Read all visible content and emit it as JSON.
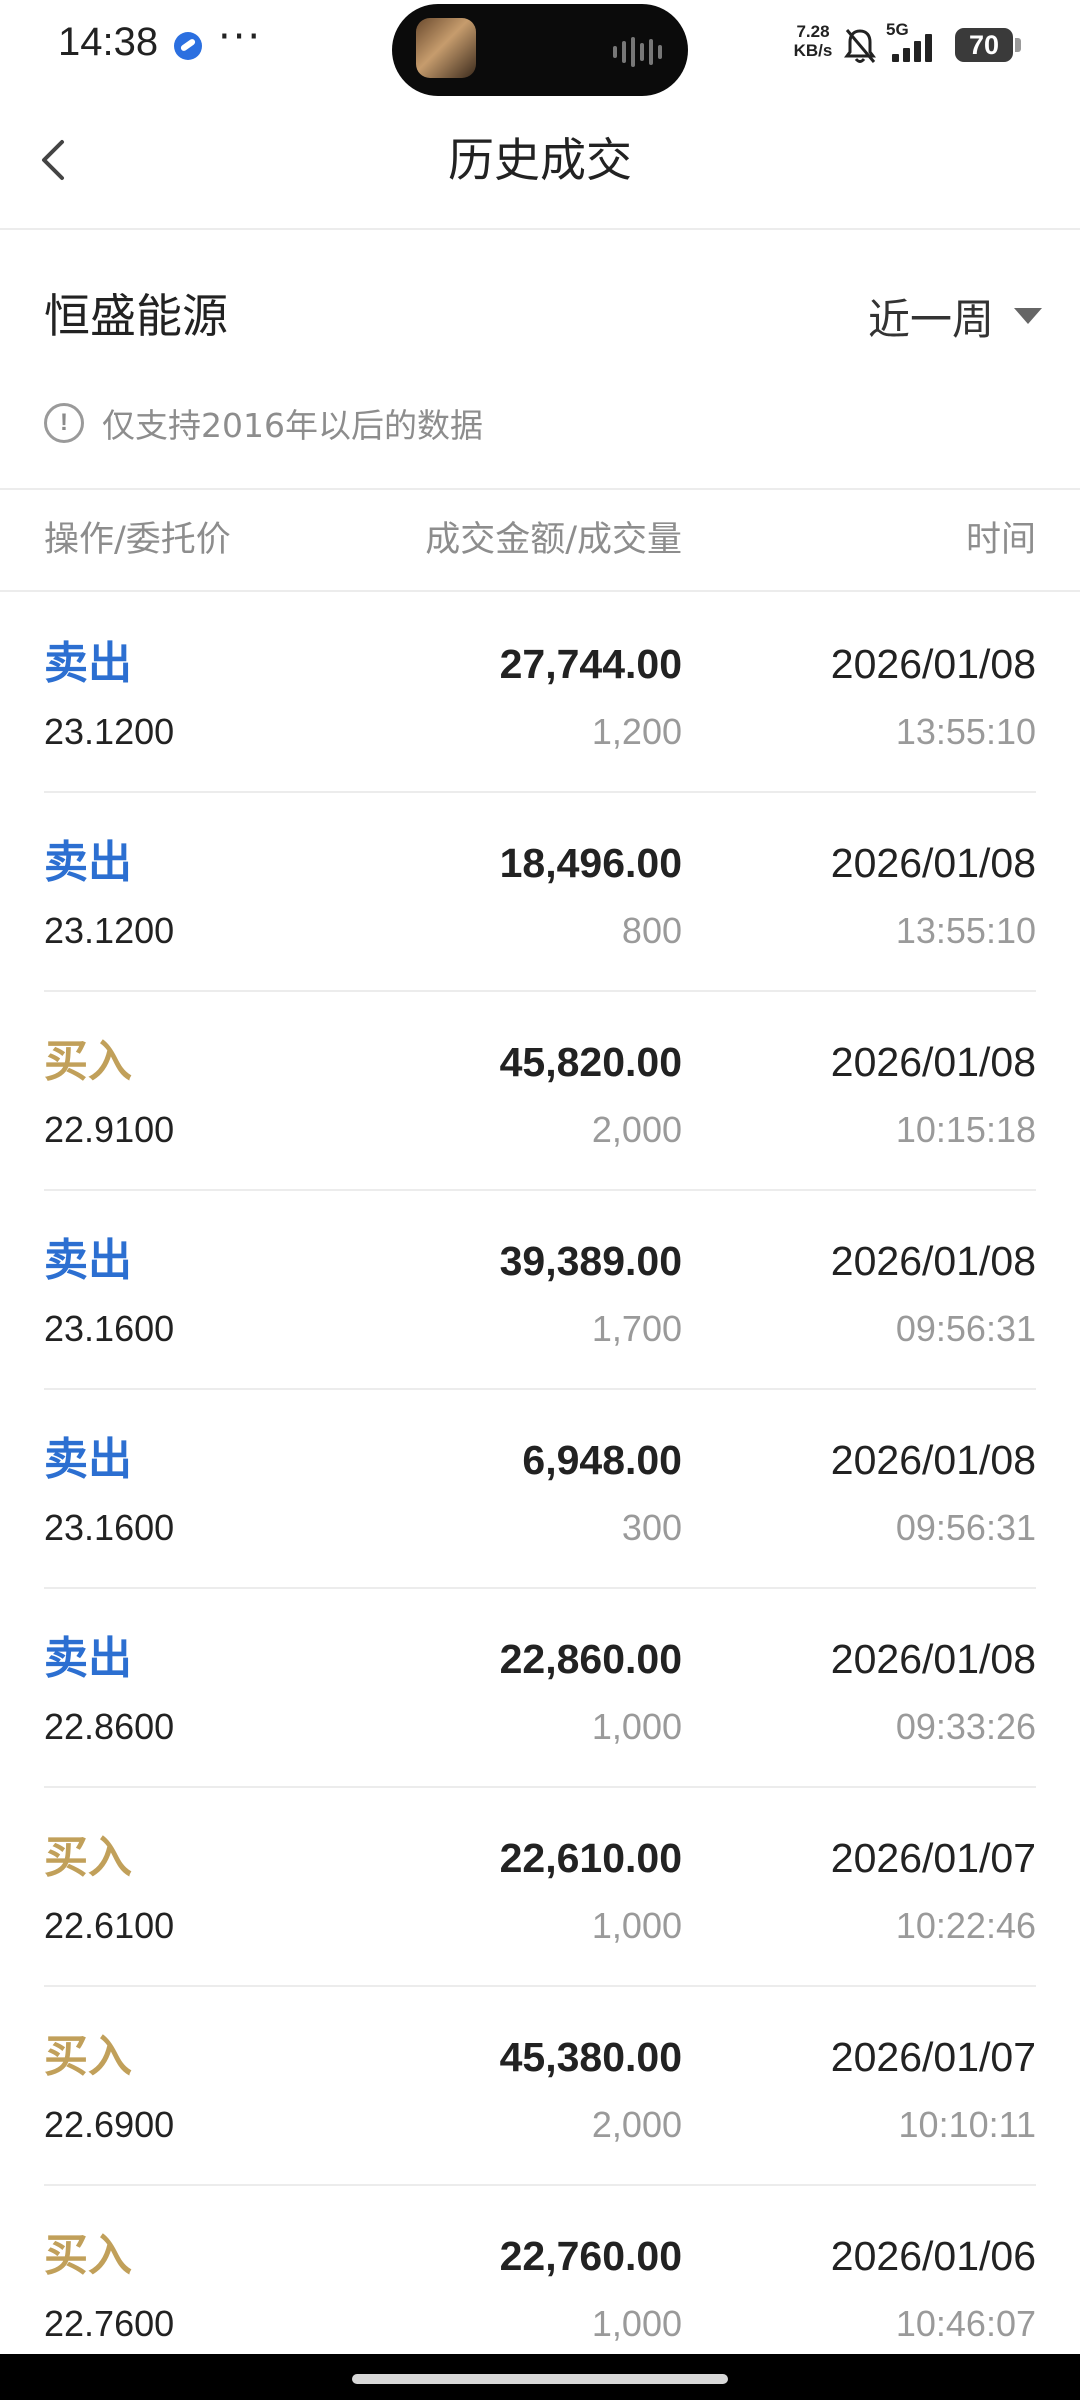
{
  "status_bar": {
    "time": "14:38",
    "more": "···",
    "net_speed_value": "7.28",
    "net_speed_unit": "KB/s",
    "network": "5G",
    "battery": "70",
    "app_icon": "blue-app-icon",
    "bell_icon": "bell-muted-icon"
  },
  "nav": {
    "title": "历史成交",
    "back_icon": "chevron-left-icon"
  },
  "stock": {
    "name": "恒盛能源",
    "period": "近一周"
  },
  "notice": {
    "icon": "!",
    "text": "仅支持2016年以后的数据"
  },
  "table": {
    "headers": {
      "operation": "操作/委托价",
      "amount": "成交金额/成交量",
      "time": "时间"
    },
    "rows": [
      {
        "action": "卖出",
        "type": "sell",
        "price": "23.1200",
        "amount": "27,744.00",
        "volume": "1,200",
        "date": "2026/01/08",
        "time": "13:55:10"
      },
      {
        "action": "卖出",
        "type": "sell",
        "price": "23.1200",
        "amount": "18,496.00",
        "volume": "800",
        "date": "2026/01/08",
        "time": "13:55:10"
      },
      {
        "action": "买入",
        "type": "buy",
        "price": "22.9100",
        "amount": "45,820.00",
        "volume": "2,000",
        "date": "2026/01/08",
        "time": "10:15:18"
      },
      {
        "action": "卖出",
        "type": "sell",
        "price": "23.1600",
        "amount": "39,389.00",
        "volume": "1,700",
        "date": "2026/01/08",
        "time": "09:56:31"
      },
      {
        "action": "卖出",
        "type": "sell",
        "price": "23.1600",
        "amount": "6,948.00",
        "volume": "300",
        "date": "2026/01/08",
        "time": "09:56:31"
      },
      {
        "action": "卖出",
        "type": "sell",
        "price": "22.8600",
        "amount": "22,860.00",
        "volume": "1,000",
        "date": "2026/01/08",
        "time": "09:33:26"
      },
      {
        "action": "买入",
        "type": "buy",
        "price": "22.6100",
        "amount": "22,610.00",
        "volume": "1,000",
        "date": "2026/01/07",
        "time": "10:22:46"
      },
      {
        "action": "买入",
        "type": "buy",
        "price": "22.6900",
        "amount": "45,380.00",
        "volume": "2,000",
        "date": "2026/01/07",
        "time": "10:10:11"
      },
      {
        "action": "买入",
        "type": "buy",
        "price": "22.7600",
        "amount": "22,760.00",
        "volume": "1,000",
        "date": "2026/01/06",
        "time": "10:46:07"
      }
    ]
  },
  "colors": {
    "sell": "#2c6fd1",
    "buy": "#c1a05a",
    "text_primary": "#222222",
    "text_secondary": "#9a9a9a"
  }
}
